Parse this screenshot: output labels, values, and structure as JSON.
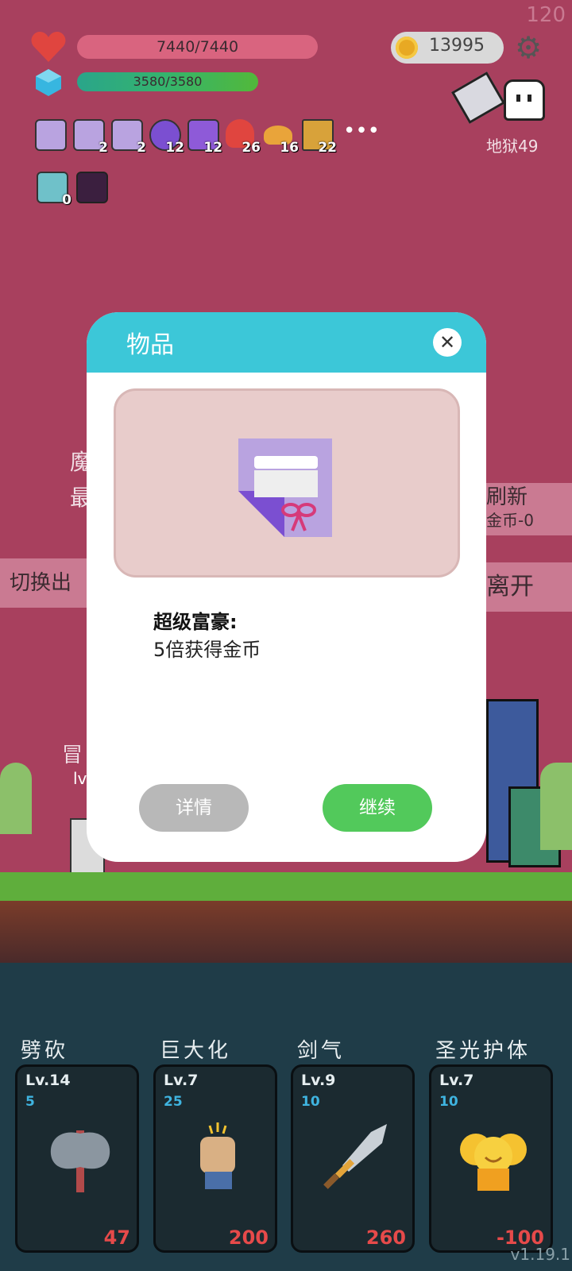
{
  "hud": {
    "fps": "120",
    "hp_text": "7440/7440",
    "mp_text": "3580/3580",
    "coins": "13995",
    "level_label": "地狱49"
  },
  "inventory": [
    {
      "icon": "gift-scroll-icon",
      "count": ""
    },
    {
      "icon": "gift-scroll-icon",
      "count": "2"
    },
    {
      "icon": "gift-scroll-icon",
      "count": "2"
    },
    {
      "icon": "potion-icon",
      "count": "12"
    },
    {
      "icon": "treasure-chest-icon",
      "count": "12"
    },
    {
      "icon": "heart-icon",
      "count": "26"
    },
    {
      "icon": "bread-icon",
      "count": "16"
    },
    {
      "icon": "book-icon",
      "count": "22"
    }
  ],
  "inventory_row2": [
    {
      "icon": "lightbulb-icon",
      "count": "0"
    },
    {
      "icon": "demon-icon",
      "count": ""
    }
  ],
  "background": {
    "left_partial_1": "魔",
    "left_partial_2": "最",
    "switch_btn": "切换出",
    "refresh_btn": "刷新",
    "refresh_cost": "金币-0",
    "leave_btn": "离开",
    "adventurer_partial": "冒",
    "adventurer_lv": "lv"
  },
  "modal": {
    "title": "物品",
    "item_name": "超级富豪:",
    "item_desc": "5倍获得金币",
    "detail_btn": "详情",
    "continue_btn": "继续"
  },
  "skills": [
    {
      "name": "劈砍",
      "level": "Lv.14",
      "cost": "5",
      "price": "47",
      "icon": "axe-icon"
    },
    {
      "name": "巨大化",
      "level": "Lv.7",
      "cost": "25",
      "price": "200",
      "icon": "fist-icon"
    },
    {
      "name": "剑气",
      "level": "Lv.9",
      "cost": "10",
      "price": "260",
      "icon": "sword-icon"
    },
    {
      "name": "圣光护体",
      "level": "Lv.7",
      "cost": "10",
      "price": "-100",
      "icon": "holy-shield-icon"
    }
  ],
  "version": "v1.19.1",
  "colors": {
    "bg": "#a8405e",
    "modal_header": "#3cc7d8",
    "continue": "#52c95b",
    "detail": "#b8b8b8",
    "price": "#e64a4a"
  }
}
